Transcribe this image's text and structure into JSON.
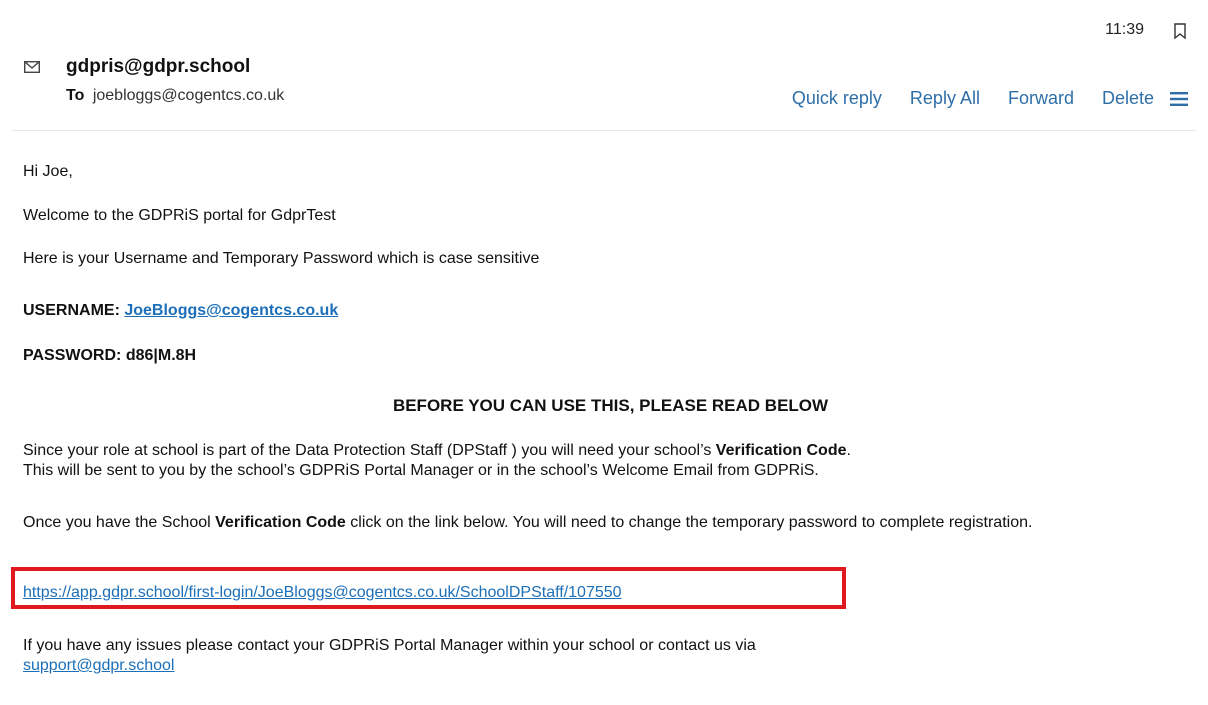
{
  "header": {
    "time": "11:39",
    "sender": "gdpris@gdpr.school",
    "to_label": "To",
    "to_address": "joebloggs@cogentcs.co.uk",
    "actions": {
      "quick_reply": "Quick reply",
      "reply_all": "Reply All",
      "forward": "Forward",
      "delete": "Delete"
    },
    "icons": [
      "envelope-icon",
      "flag-icon",
      "hamburger-menu-icon"
    ]
  },
  "body": {
    "greeting": "Hi Joe,",
    "welcome": "Welcome to the GDPRiS portal for GdprTest",
    "intro": "Here is your Username and Temporary Password which is case sensitive",
    "username_label": "USERNAME:",
    "username_value": "JoeBloggs@cogentcs.co.uk",
    "password_label": "PASSWORD:",
    "password_value": "d86|M.8H",
    "warning": "BEFORE YOU CAN USE THIS, PLEASE READ BELOW",
    "role_para_1": "Since your role at school is part of the Data Protection Staff (DPStaff ) you will need your school’s ",
    "role_para_bold": "Verification Code",
    "role_para_2": ".",
    "role_para_3": "This will be sent to you by the school’s GDPRiS Portal Manager or in the school’s Welcome Email from GDPRiS.",
    "code_para_1": "Once you have the School ",
    "code_para_bold": "Verification Code",
    "code_para_2": " click on the link below. You will need to change the temporary password to complete registration.",
    "first_login_link": "https://app.gdpr.school/first-login/JoeBloggs@cogentcs.co.uk/SchoolDPStaff/107550",
    "issues_text": "If you have any issues please contact your GDPRiS Portal Manager within your school or contact us via",
    "support_email": "support@gdpr.school"
  },
  "colors": {
    "link": "#1c6fb8",
    "action": "#2f6fa8",
    "highlight_box": "#e0191e"
  }
}
